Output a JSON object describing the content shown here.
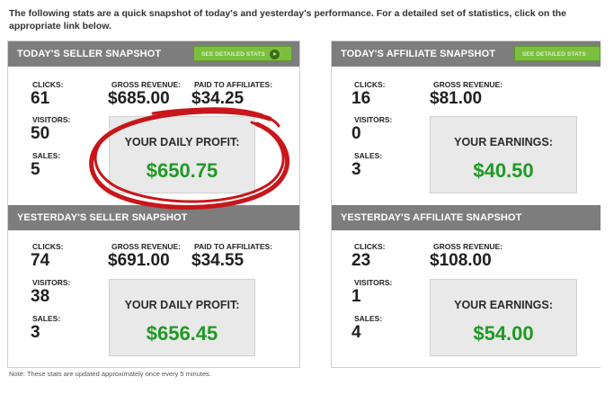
{
  "intro_text": "The following stats are a quick snapshot of today's and yesterday's performance. For a detailed set of statistics, click on the appropriate link below.",
  "details_button_label": "SEE DETAILED STATS",
  "details_button_label_aff": "SEE DETAILED STATS",
  "seller_today": {
    "title": "TODAY'S SELLER SNAPSHOT",
    "clicks_label": "CLICKS:",
    "clicks": "61",
    "visitors_label": "VISITORS:",
    "visitors": "50",
    "sales_label": "SALES:",
    "sales": "5",
    "gross_label": "GROSS REVENUE:",
    "gross": "$685.00",
    "paid_label": "PAID TO AFFILIATES:",
    "paid": "$34.25",
    "profit_label": "YOUR DAILY PROFIT:",
    "profit": "$650.75"
  },
  "seller_yesterday": {
    "title": "YESTERDAY'S SELLER SNAPSHOT",
    "clicks_label": "CLICKS:",
    "clicks": "74",
    "visitors_label": "VISITORS:",
    "visitors": "38",
    "sales_label": "SALES:",
    "sales": "3",
    "gross_label": "GROSS REVENUE:",
    "gross": "$691.00",
    "paid_label": "PAID TO AFFILIATES:",
    "paid": "$34.55",
    "profit_label": "YOUR DAILY PROFIT:",
    "profit": "$656.45"
  },
  "aff_today": {
    "title": "TODAY'S AFFILIATE SNAPSHOT",
    "clicks_label": "CLICKS:",
    "clicks": "16",
    "visitors_label": "VISITORS:",
    "visitors": "0",
    "sales_label": "SALES:",
    "sales": "3",
    "gross_label": "GROSS REVENUE:",
    "gross": "$81.00",
    "earn_label": "YOUR EARNINGS:",
    "earn": "$40.50"
  },
  "aff_yesterday": {
    "title": "YESTERDAY'S AFFILIATE SNAPSHOT",
    "clicks_label": "CLICKS:",
    "clicks": "23",
    "visitors_label": "VISITORS:",
    "visitors": "1",
    "sales_label": "SALES:",
    "sales": "4",
    "gross_label": "GROSS REVENUE:",
    "gross": "$108.00",
    "earn_label": "YOUR EARNINGS:",
    "earn": "$54.00"
  },
  "note": "Note: These stats are updated approximately once every 5 minutes.",
  "colors": {
    "header_bar": "#7d7d7d",
    "profit_green": "#1f9a24",
    "button_green": "#7cbf3f",
    "highlight_red": "#c8161b"
  },
  "icons": {
    "details_button": "play-circle-icon",
    "annotation": "hand-drawn-red-circle"
  }
}
